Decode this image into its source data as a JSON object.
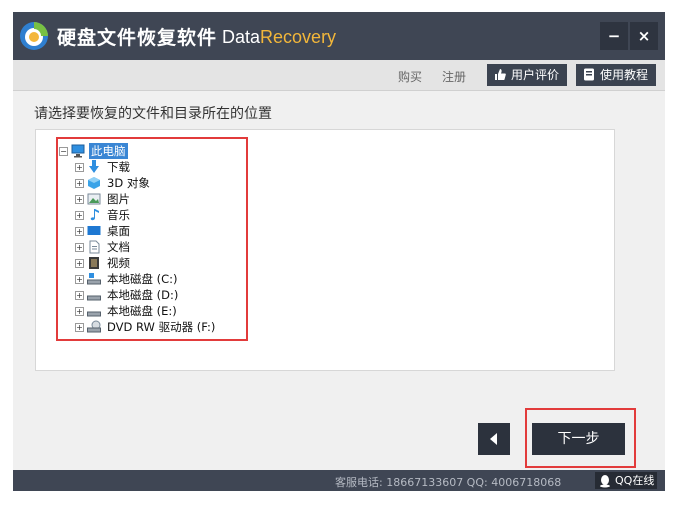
{
  "app": {
    "title": "硬盘文件恢复软件",
    "brand_part1": "Data",
    "brand_part2": "Recovery",
    "minimize_label": "−",
    "close_label": "×"
  },
  "menu": {
    "buy": "购买",
    "register": "注册",
    "review": "用户评价",
    "tutorial": "使用教程"
  },
  "main": {
    "prompt": "请选择要恢复的文件和目录所在的位置"
  },
  "tree": {
    "root": {
      "label": "此电脑",
      "expander": "⊟",
      "icon": "computer-icon"
    },
    "items": [
      {
        "label": "下载",
        "expander": "⊞",
        "icon": "download-icon"
      },
      {
        "label": "3D 对象",
        "expander": "⊞",
        "icon": "3d-objects-icon"
      },
      {
        "label": "图片",
        "expander": "⊞",
        "icon": "pictures-icon"
      },
      {
        "label": "音乐",
        "expander": "⊞",
        "icon": "music-icon"
      },
      {
        "label": "桌面",
        "expander": "⊞",
        "icon": "desktop-icon"
      },
      {
        "label": "文档",
        "expander": "⊞",
        "icon": "documents-icon"
      },
      {
        "label": "视频",
        "expander": "⊞",
        "icon": "videos-icon"
      },
      {
        "label": "本地磁盘 (C:)",
        "expander": "⊞",
        "icon": "system-drive-icon"
      },
      {
        "label": "本地磁盘 (D:)",
        "expander": "⊞",
        "icon": "drive-icon"
      },
      {
        "label": "本地磁盘 (E:)",
        "expander": "⊞",
        "icon": "drive-icon"
      },
      {
        "label": "DVD RW 驱动器 (F:)",
        "expander": "⊞",
        "icon": "dvd-drive-icon"
      }
    ]
  },
  "nav": {
    "next_label": "下一步"
  },
  "status": {
    "hotline": "客服电话: 18667133607 QQ: 4006718068",
    "qq_online": "QQ在线"
  },
  "colors": {
    "titlebar": "#3f4654",
    "accent_orange": "#f3b73a",
    "highlight_red": "#e23b3b",
    "selection_blue": "#3a86d4"
  }
}
